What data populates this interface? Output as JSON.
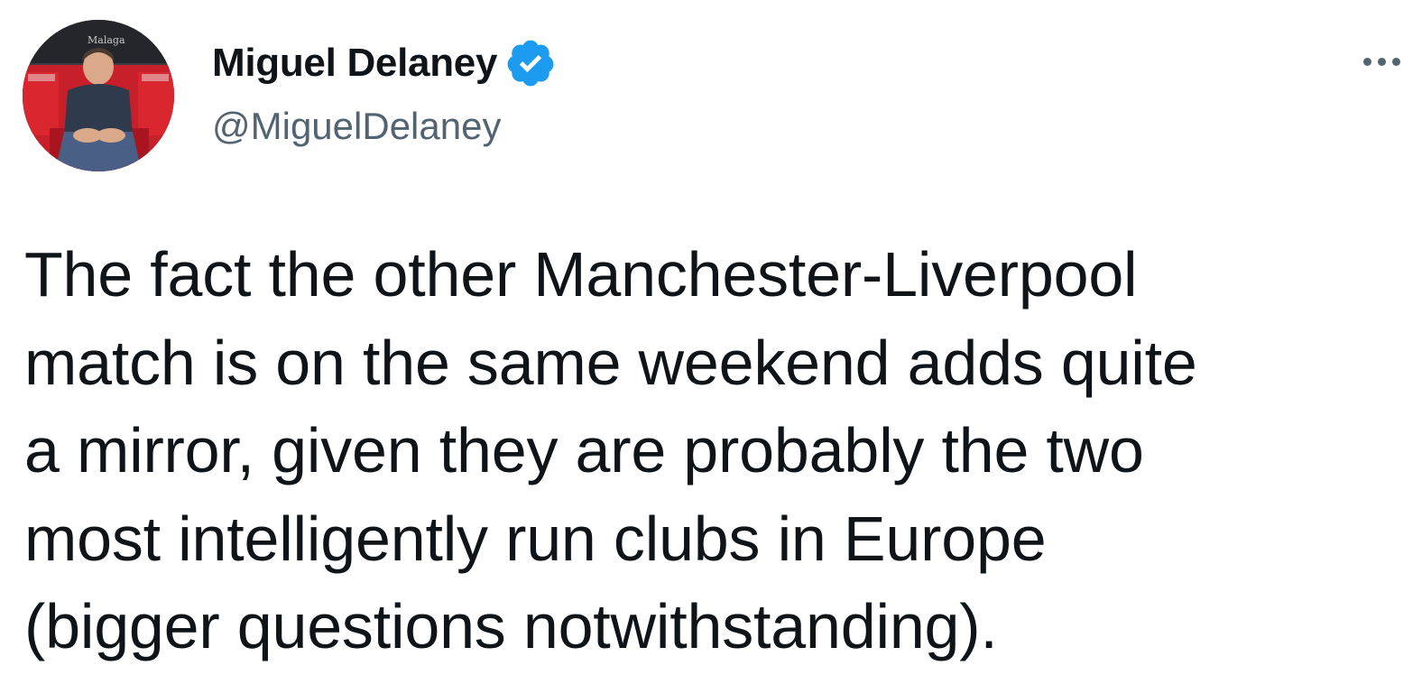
{
  "tweet": {
    "author": {
      "display_name": "Miguel Delaney",
      "handle": "@MiguelDelaney",
      "verified": true,
      "avatar_icon": "profile-photo"
    },
    "menu_icon": "more-options-icon",
    "text_lines": [
      "The fact the other Manchester-Liverpool",
      "match is on the same weekend adds quite",
      "a mirror, given they are probably the two",
      "most intelligently run clubs in Europe",
      "(bigger questions notwithstanding)."
    ]
  },
  "colors": {
    "text_primary": "#0f1419",
    "text_secondary": "#536471",
    "verified_blue": "#1d9bf0",
    "background": "#ffffff"
  }
}
